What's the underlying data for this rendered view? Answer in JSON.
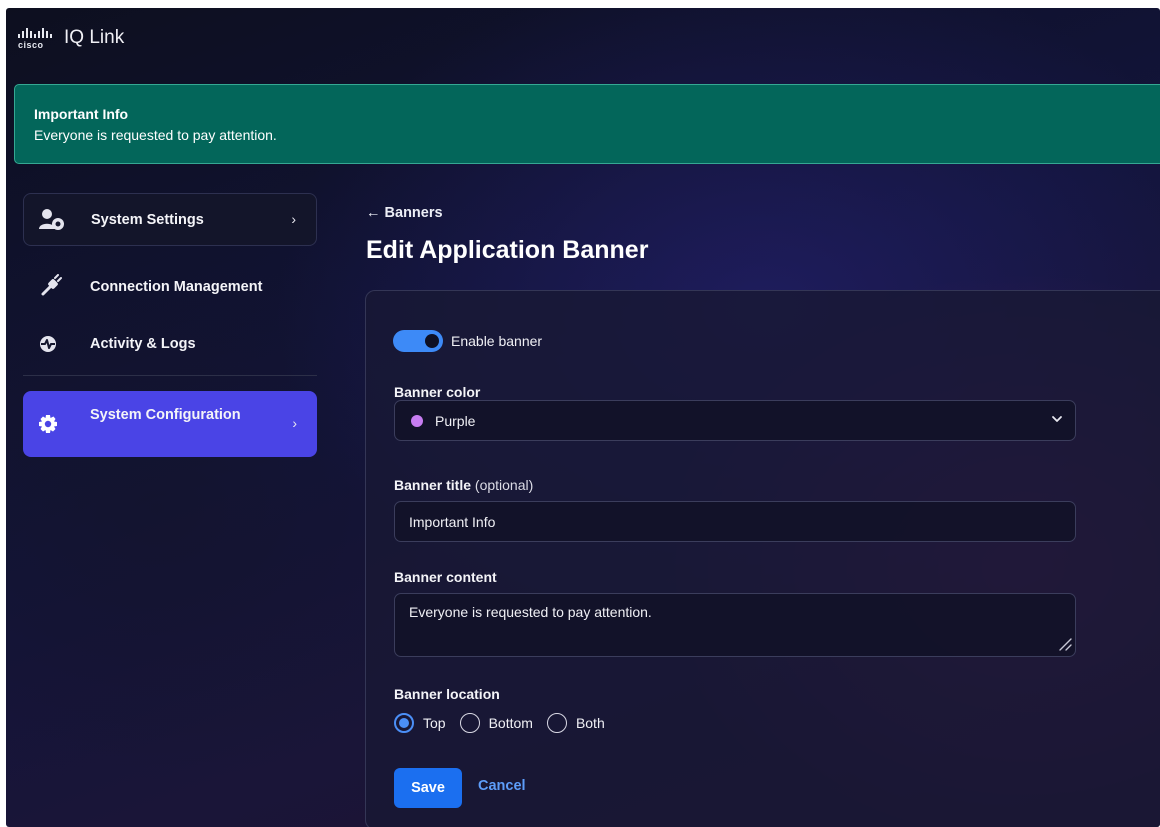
{
  "app": {
    "logo_text": "cisco",
    "title": "IQ Link"
  },
  "banner_preview": {
    "title": "Important Info",
    "text": "Everyone is requested to pay attention."
  },
  "sidebar": {
    "items": [
      {
        "label": "System Settings",
        "icon": "user-gear-icon",
        "chevron": "›"
      },
      {
        "label": "Connection Management",
        "icon": "plug-icon"
      },
      {
        "label": "Activity & Logs",
        "icon": "activity-icon"
      },
      {
        "label": "System Configuration",
        "icon": "gear-icon",
        "chevron": "›",
        "active": true
      }
    ]
  },
  "page": {
    "back_label": "← Banners",
    "title": "Edit Application Banner"
  },
  "form": {
    "enable_label": "Enable banner",
    "enabled": true,
    "color_label": "Banner color",
    "color_value": "Purple",
    "color_swatch": "#c77df2",
    "title_label": "Banner title",
    "title_optional": "(optional)",
    "title_value": "Important Info",
    "content_label": "Banner content",
    "content_value": "Everyone is requested to pay attention.",
    "location_label": "Banner location",
    "location_options": [
      "Top",
      "Bottom",
      "Both"
    ],
    "location_selected": "Top",
    "save_label": "Save",
    "cancel_label": "Cancel"
  },
  "colors": {
    "accent": "#1b6ff0",
    "banner_green": "#03665a",
    "active_nav": "#4a44e6"
  }
}
